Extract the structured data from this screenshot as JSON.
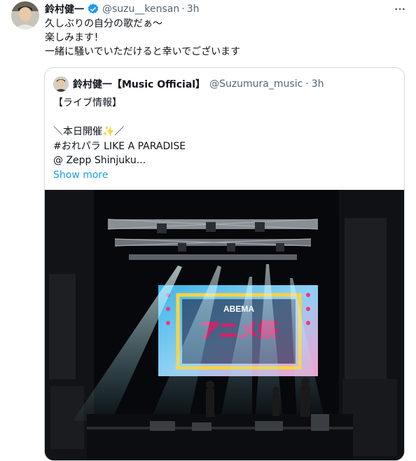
{
  "tweet": {
    "author_name": "鈴村健一",
    "handle": "@suzu__kensan",
    "separator": "·",
    "time": "3h",
    "lines": [
      "久しぶりの自分の歌だぁ〜",
      "楽しみます！",
      "一緒に騒いでいただけると幸いでございます"
    ]
  },
  "quoted": {
    "author_name": "鈴村健一【Music Official】",
    "handle": "@Suzumura_music",
    "separator": "·",
    "time": "3h",
    "lines": [
      "【ライブ情報】",
      "",
      "＼本日開催✨／",
      "#おれパラ LIKE A PARADISE",
      "@ Zepp Shinjuku..."
    ],
    "show_more": "Show more",
    "image": {
      "screen_logo": "ABEMA",
      "screen_title": "アニメ祭"
    }
  },
  "colors": {
    "accent": "#1d9bf0",
    "secondary_text": "#536471",
    "border": "#cfd9de"
  },
  "icons": {
    "verified": "verified-badge-icon",
    "more": "more-options-icon"
  }
}
